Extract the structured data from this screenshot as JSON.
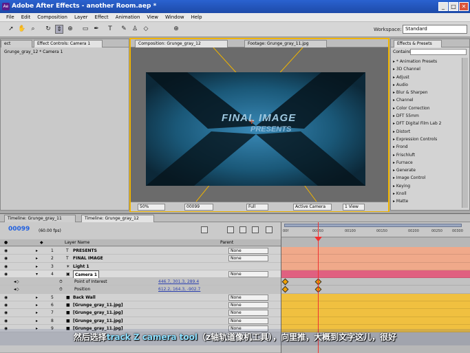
{
  "window": {
    "title": "Adobe After Effects - another Room.aep *",
    "app_icon": "Ae",
    "min": "_",
    "max": "□",
    "close": "✕"
  },
  "menu": [
    "File",
    "Edit",
    "Composition",
    "Layer",
    "Effect",
    "Animation",
    "View",
    "Window",
    "Help"
  ],
  "toolbar": {
    "workspace_label": "Workspace:",
    "workspace_value": "Standard"
  },
  "left_panel": {
    "tabs": [
      "ect",
      "Effect Controls: Camera 1"
    ],
    "subtitle": "Grunge_gray_12 * Camera 1"
  },
  "comp_panel": {
    "tabs": [
      "Composition: Grunge_gray_12",
      "Footage: Grunge_gray_11.jpg"
    ],
    "headline": "FINAL IMAGE",
    "subline": "PRESENTS",
    "footer": {
      "zoom": "50%",
      "timecode": "00099",
      "resolution": "Full",
      "camera": "Active Camera",
      "view": "1 View"
    }
  },
  "effects_panel": {
    "tab": "Effects & Presets",
    "contains_label": "Contains:",
    "items": [
      "* Animation Presets",
      "3D Channel",
      "Adjust",
      "Audio",
      "Blur & Sharpen",
      "Channel",
      "Color Correction",
      "DFT 55mm",
      "DFT Digital Film Lab 2",
      "Distort",
      "Expression Controls",
      "Frond",
      "Frischluft",
      "Furnace",
      "Generate",
      "Image Control",
      "Keying",
      "Knoll",
      "Matte"
    ]
  },
  "timeline": {
    "tabs": [
      "Timeline: Grunge_gray_11",
      "Timeline: Grunge_gray_12"
    ],
    "timecode": "00099",
    "fps": "(60.00 fps)",
    "col_layer_name": "Layer Name",
    "col_parent": "Parent",
    "ruler": [
      "00f",
      "00050",
      "00100",
      "00150",
      "00200",
      "00250",
      "00300"
    ],
    "layers": [
      {
        "num": "1",
        "name": "PRESENTS",
        "parent": "None",
        "kind": "T"
      },
      {
        "num": "2",
        "name": "FINAL IMAGE",
        "parent": "None",
        "kind": "T"
      },
      {
        "num": "3",
        "name": "Light 1",
        "parent": "",
        "kind": "☀"
      },
      {
        "num": "4",
        "name": "Camera 1",
        "parent": "None",
        "kind": "▣"
      },
      {
        "num": "",
        "name": "Point of Interest",
        "parent": "",
        "value": "446.7, 301.3, 289.4",
        "sub": true
      },
      {
        "num": "",
        "name": "Position",
        "parent": "",
        "value": "612.2, 164.3, -902.7",
        "sub": true
      },
      {
        "num": "5",
        "name": "Back Wall",
        "parent": "None",
        "kind": "■"
      },
      {
        "num": "6",
        "name": "[Grunge_gray_11.jpg]",
        "parent": "None",
        "kind": "■"
      },
      {
        "num": "7",
        "name": "[Grunge_gray_11.jpg]",
        "parent": "None",
        "kind": "■"
      },
      {
        "num": "8",
        "name": "[Grunge_gray_11.jpg]",
        "parent": "None",
        "kind": "■"
      },
      {
        "num": "9",
        "name": "[Grunge_gray_11.jpg]",
        "parent": "None",
        "kind": "■"
      }
    ]
  },
  "caption": {
    "lead": "然后选择",
    "highlight": "track Z camera tool",
    "tail": "（z轴轨道像机工具），向里推，大概到文字这儿，很好"
  },
  "colors": {
    "timecode": "#1f5fe0",
    "text_layer_bar": "#f0a98a",
    "camera_bar": "#e06080",
    "footage_bar": "#f0c040",
    "panel_highlight": "#f0b400"
  }
}
